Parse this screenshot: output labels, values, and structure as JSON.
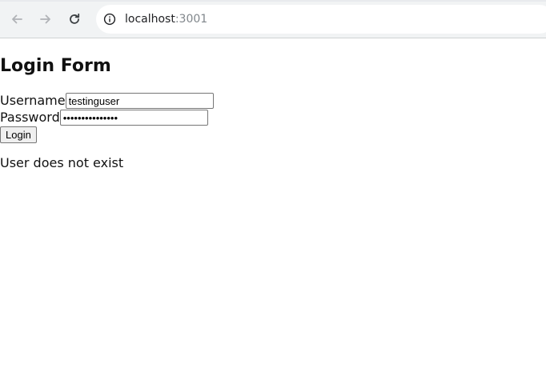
{
  "browser": {
    "url_host": "localhost",
    "url_port": ":3001",
    "icons": {
      "back": "arrow-left-icon",
      "forward": "arrow-right-icon",
      "reload": "reload-icon",
      "site_info": "info-icon"
    }
  },
  "page": {
    "title": "Login Form",
    "username": {
      "label": "Username",
      "value": "testinguser"
    },
    "password": {
      "label": "Password",
      "value": "testingpassword"
    },
    "login_label": "Login",
    "message": "User does not exist"
  }
}
